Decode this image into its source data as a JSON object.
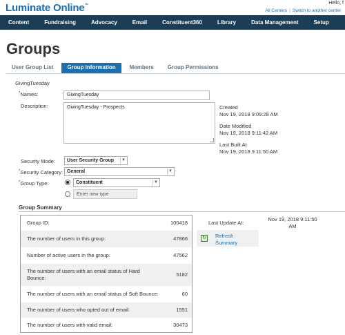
{
  "header": {
    "logo": "Luminate Online",
    "logo_tm": "™",
    "hello": "Hello, f",
    "links": [
      "All Centers",
      "Switch to another center"
    ]
  },
  "nav": [
    "Content",
    "Fundraising",
    "Advocacy",
    "Email",
    "Constituent360",
    "Library",
    "Data Management",
    "Setup"
  ],
  "page_title": "Groups",
  "tabs": [
    {
      "label": "User Group List",
      "active": false
    },
    {
      "label": "Group Information",
      "active": true
    },
    {
      "label": "Members",
      "active": false
    },
    {
      "label": "Group Permissions",
      "active": false
    }
  ],
  "group_name_heading": "GivingTuesday",
  "form": {
    "names_label": "Names:",
    "names_value": "GivingTuesday",
    "description_label": "Description:",
    "description_value": "GivingTuesday - Prospects",
    "security_mode_label": "Security Mode:",
    "security_mode_value": "User Security Group",
    "security_category_label": "Security Category:",
    "security_category_value": "General",
    "group_type_label": "Group Type:",
    "group_type_value": "Constituent",
    "new_type_label": "Enter new type"
  },
  "meta": {
    "created_label": "Created",
    "created_value": "Nov 19, 2018 9:09:28 AM",
    "modified_label": "Date Modified",
    "modified_value": "Nov 19, 2018 9:11:42 AM",
    "built_label": "Last Built At",
    "built_value": "Nov 19, 2018 9:11:50 AM"
  },
  "summary": {
    "title": "Group Summary",
    "rows": [
      {
        "label": "Group ID:",
        "value": "100418"
      },
      {
        "label": "The number of users in this group:",
        "value": "47866"
      },
      {
        "label": "Number of active users in the group:",
        "value": "47562"
      },
      {
        "label": "The number of users with an email status of Hard Bounce:",
        "value": "5182"
      },
      {
        "label": "The number of users with an email status of Soft Bounce:",
        "value": "60"
      },
      {
        "label": "The number of users who opted out of email:",
        "value": "1551"
      },
      {
        "label": "The number of users with valid email:",
        "value": "30473"
      }
    ],
    "last_update_label": "Last Update At:",
    "last_update_value": "Nov 19, 2018 9:11:50 AM",
    "refresh_label": "Refresh Summary"
  }
}
